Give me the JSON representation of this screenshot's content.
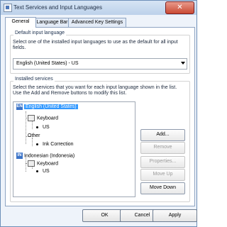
{
  "window": {
    "title": "Text Services and Input Languages",
    "close_glyph": "✕"
  },
  "tabs": [
    {
      "label": "General",
      "active": true
    },
    {
      "label": "Language Bar",
      "active": false
    },
    {
      "label": "Advanced Key Settings",
      "active": false
    }
  ],
  "default_input": {
    "group_label": "Default input language",
    "description": "Select one of the installed input languages to use as the default for all input fields.",
    "selected_value": "English (United States) - US"
  },
  "installed": {
    "group_label": "Installed services",
    "description": "Select the services that you want for each input language shown in the list. Use the Add and Remove buttons to modify this list.",
    "tree": {
      "lang1": {
        "badge": "EN",
        "name": "English (United States)"
      },
      "lang1_keyboard": "Keyboard",
      "lang1_keyboard_item": "US",
      "lang1_other": "Other",
      "lang1_other_item": "Ink Correction",
      "lang2": {
        "badge": "IN",
        "name": "Indonesian (Indonesia)"
      },
      "lang2_keyboard": "Keyboard",
      "lang2_keyboard_item": "US"
    },
    "buttons": {
      "add": "Add...",
      "remove": "Remove",
      "properties": "Properties...",
      "move_up": "Move Up",
      "move_down": "Move Down"
    }
  },
  "dialog_buttons": {
    "ok": "OK",
    "cancel": "Cancel",
    "apply": "Apply"
  },
  "colors": {
    "accent": "#3399ff",
    "window_border": "#6d8fb8"
  }
}
